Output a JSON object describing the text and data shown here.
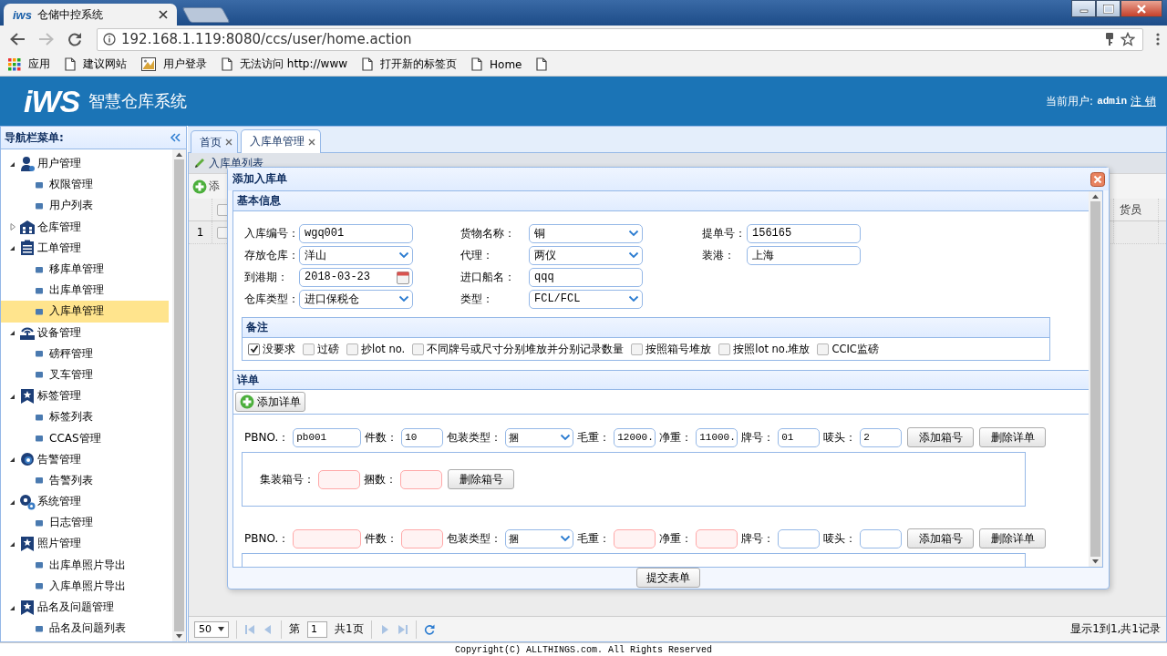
{
  "browser": {
    "tab_logo": "iws",
    "tab_title": "仓储中控系统",
    "url": "192.168.1.119:8080/ccs/user/home.action",
    "bookmarks": [
      {
        "kind": "apps",
        "label": "应用"
      },
      {
        "kind": "page",
        "label": "建议网站"
      },
      {
        "kind": "image",
        "label": "用户登录"
      },
      {
        "kind": "page",
        "label": "无法访问 http://www"
      },
      {
        "kind": "page",
        "label": "打开新的标签页"
      },
      {
        "kind": "page",
        "label": "Home"
      },
      {
        "kind": "page"
      }
    ]
  },
  "header": {
    "logo": "iWS",
    "title": "智慧仓库系统",
    "user_label": "当前用户:",
    "username": "admin",
    "logout": "注 销"
  },
  "sidebar": {
    "title": "导航栏菜单:",
    "items": [
      {
        "label": "用户管理",
        "expanded": true,
        "children": [
          {
            "label": "权限管理",
            "selected": false
          },
          {
            "label": "用户列表",
            "selected": false
          }
        ]
      },
      {
        "label": "仓库管理",
        "expanded": false
      },
      {
        "label": "工单管理",
        "expanded": true,
        "children": [
          {
            "label": "移库单管理",
            "selected": false
          },
          {
            "label": "出库单管理",
            "selected": false
          },
          {
            "label": "入库单管理",
            "selected": true
          }
        ]
      },
      {
        "label": "设备管理",
        "expanded": true,
        "children": [
          {
            "label": "磅秤管理",
            "selected": false
          },
          {
            "label": "叉车管理",
            "selected": false
          }
        ]
      },
      {
        "label": "标签管理",
        "expanded": true,
        "children": [
          {
            "label": "标签列表",
            "selected": false
          },
          {
            "label": "CCAS管理",
            "selected": false
          }
        ]
      },
      {
        "label": "告警管理",
        "expanded": true,
        "children": [
          {
            "label": "告警列表",
            "selected": false
          }
        ]
      },
      {
        "label": "系统管理",
        "expanded": true,
        "children": [
          {
            "label": "日志管理",
            "selected": false
          }
        ]
      },
      {
        "label": "照片管理",
        "expanded": true,
        "children": [
          {
            "label": "出库单照片导出",
            "selected": false
          },
          {
            "label": "入库单照片导出",
            "selected": false
          }
        ]
      },
      {
        "label": "品名及问题管理",
        "expanded": true,
        "children": [
          {
            "label": "品名及问题列表",
            "selected": false
          }
        ]
      }
    ]
  },
  "tabs": [
    {
      "label": "首页",
      "selected": false
    },
    {
      "label": "入库单管理",
      "selected": true
    }
  ],
  "panel": {
    "title": "入库单列表",
    "toolbar": [
      "添"
    ],
    "grid": {
      "header_checked": false,
      "columns": [
        "货员"
      ],
      "rows": [
        {
          "row_number": "1",
          "checked": false
        }
      ]
    },
    "pager": {
      "page_size": "50",
      "page_label": "第",
      "page": "1",
      "page_total": "共1页",
      "info": "显示1到1,共1记录"
    }
  },
  "dialog": {
    "title": "添加入库单",
    "basic_info": {
      "title": "基本信息",
      "rows": [
        [
          {
            "label": "入库编号：",
            "value": "wgq001",
            "kind": "text"
          },
          {
            "label": "货物名称：",
            "value": "铜",
            "kind": "select"
          },
          {
            "label": "提单号：",
            "value": "156165",
            "kind": "text"
          }
        ],
        [
          {
            "label": "存放仓库：",
            "value": "洋山",
            "kind": "select"
          },
          {
            "label": "代理：",
            "value": "两仪",
            "kind": "select"
          },
          {
            "label": "装港：",
            "value": "上海",
            "kind": "text"
          }
        ],
        [
          {
            "label": "到港期：",
            "value": "2018-03-23",
            "kind": "date"
          },
          {
            "label": "进口船名：",
            "value": "qqq",
            "kind": "text"
          }
        ],
        [
          {
            "label": "仓库类型：",
            "value": "进口保税仓",
            "kind": "select"
          },
          {
            "label": "类型：",
            "value": "FCL/FCL",
            "kind": "select"
          }
        ]
      ]
    },
    "remarks": {
      "title": "备注",
      "options": [
        {
          "label": "没要求",
          "checked": true
        },
        {
          "label": "过磅",
          "checked": false
        },
        {
          "label": "抄lot no.",
          "checked": false
        },
        {
          "label": "不同牌号或尺寸分别堆放并分别记录数量",
          "checked": false
        },
        {
          "label": "按照箱号堆放",
          "checked": false
        },
        {
          "label": "按照lot no.堆放",
          "checked": false
        },
        {
          "label": "CCIC监磅",
          "checked": false
        }
      ]
    },
    "details": {
      "title": "详单",
      "add_button": "添加详单",
      "entries": [
        {
          "fields": [
            {
              "label": "PBNO.：",
              "value": "pb001",
              "kind": "text",
              "invalid": false
            },
            {
              "label": "件数：",
              "value": "10",
              "kind": "text",
              "invalid": false
            },
            {
              "label": "包装类型：",
              "value": "捆",
              "kind": "select",
              "invalid": false
            },
            {
              "label": "毛重：",
              "value": "12000.",
              "kind": "text",
              "invalid": false
            },
            {
              "label": "净重：",
              "value": "11000.",
              "kind": "text",
              "invalid": false
            },
            {
              "label": "牌号：",
              "value": "01",
              "kind": "text",
              "invalid": false
            },
            {
              "label": "唛头：",
              "value": "2",
              "kind": "text",
              "invalid": false
            }
          ],
          "buttons": [
            "添加箱号",
            "删除详单"
          ],
          "containers_open": true,
          "containers": [
            {
              "fields": [
                {
                  "label": "集装箱号：",
                  "kind": "text",
                  "invalid": true
                },
                {
                  "label": "捆数：",
                  "kind": "text",
                  "invalid": true
                }
              ],
              "buttons": [
                "删除箱号"
              ]
            }
          ]
        },
        {
          "fields": [
            {
              "label": "PBNO.：",
              "kind": "text",
              "invalid": true
            },
            {
              "label": "件数：",
              "kind": "text",
              "invalid": true
            },
            {
              "label": "包装类型：",
              "value": "捆",
              "kind": "select",
              "invalid": false
            },
            {
              "label": "毛重：",
              "kind": "text",
              "invalid": true
            },
            {
              "label": "净重：",
              "kind": "text",
              "invalid": true
            },
            {
              "label": "牌号：",
              "kind": "text",
              "invalid": false
            },
            {
              "label": "唛头：",
              "kind": "text",
              "invalid": false
            }
          ],
          "buttons": [
            "添加箱号",
            "删除详单"
          ],
          "containers_open": true
        }
      ]
    },
    "submit": "提交表单"
  },
  "footer": "Copyright(C) ALLTHINGS.com. All Rights Reserved"
}
